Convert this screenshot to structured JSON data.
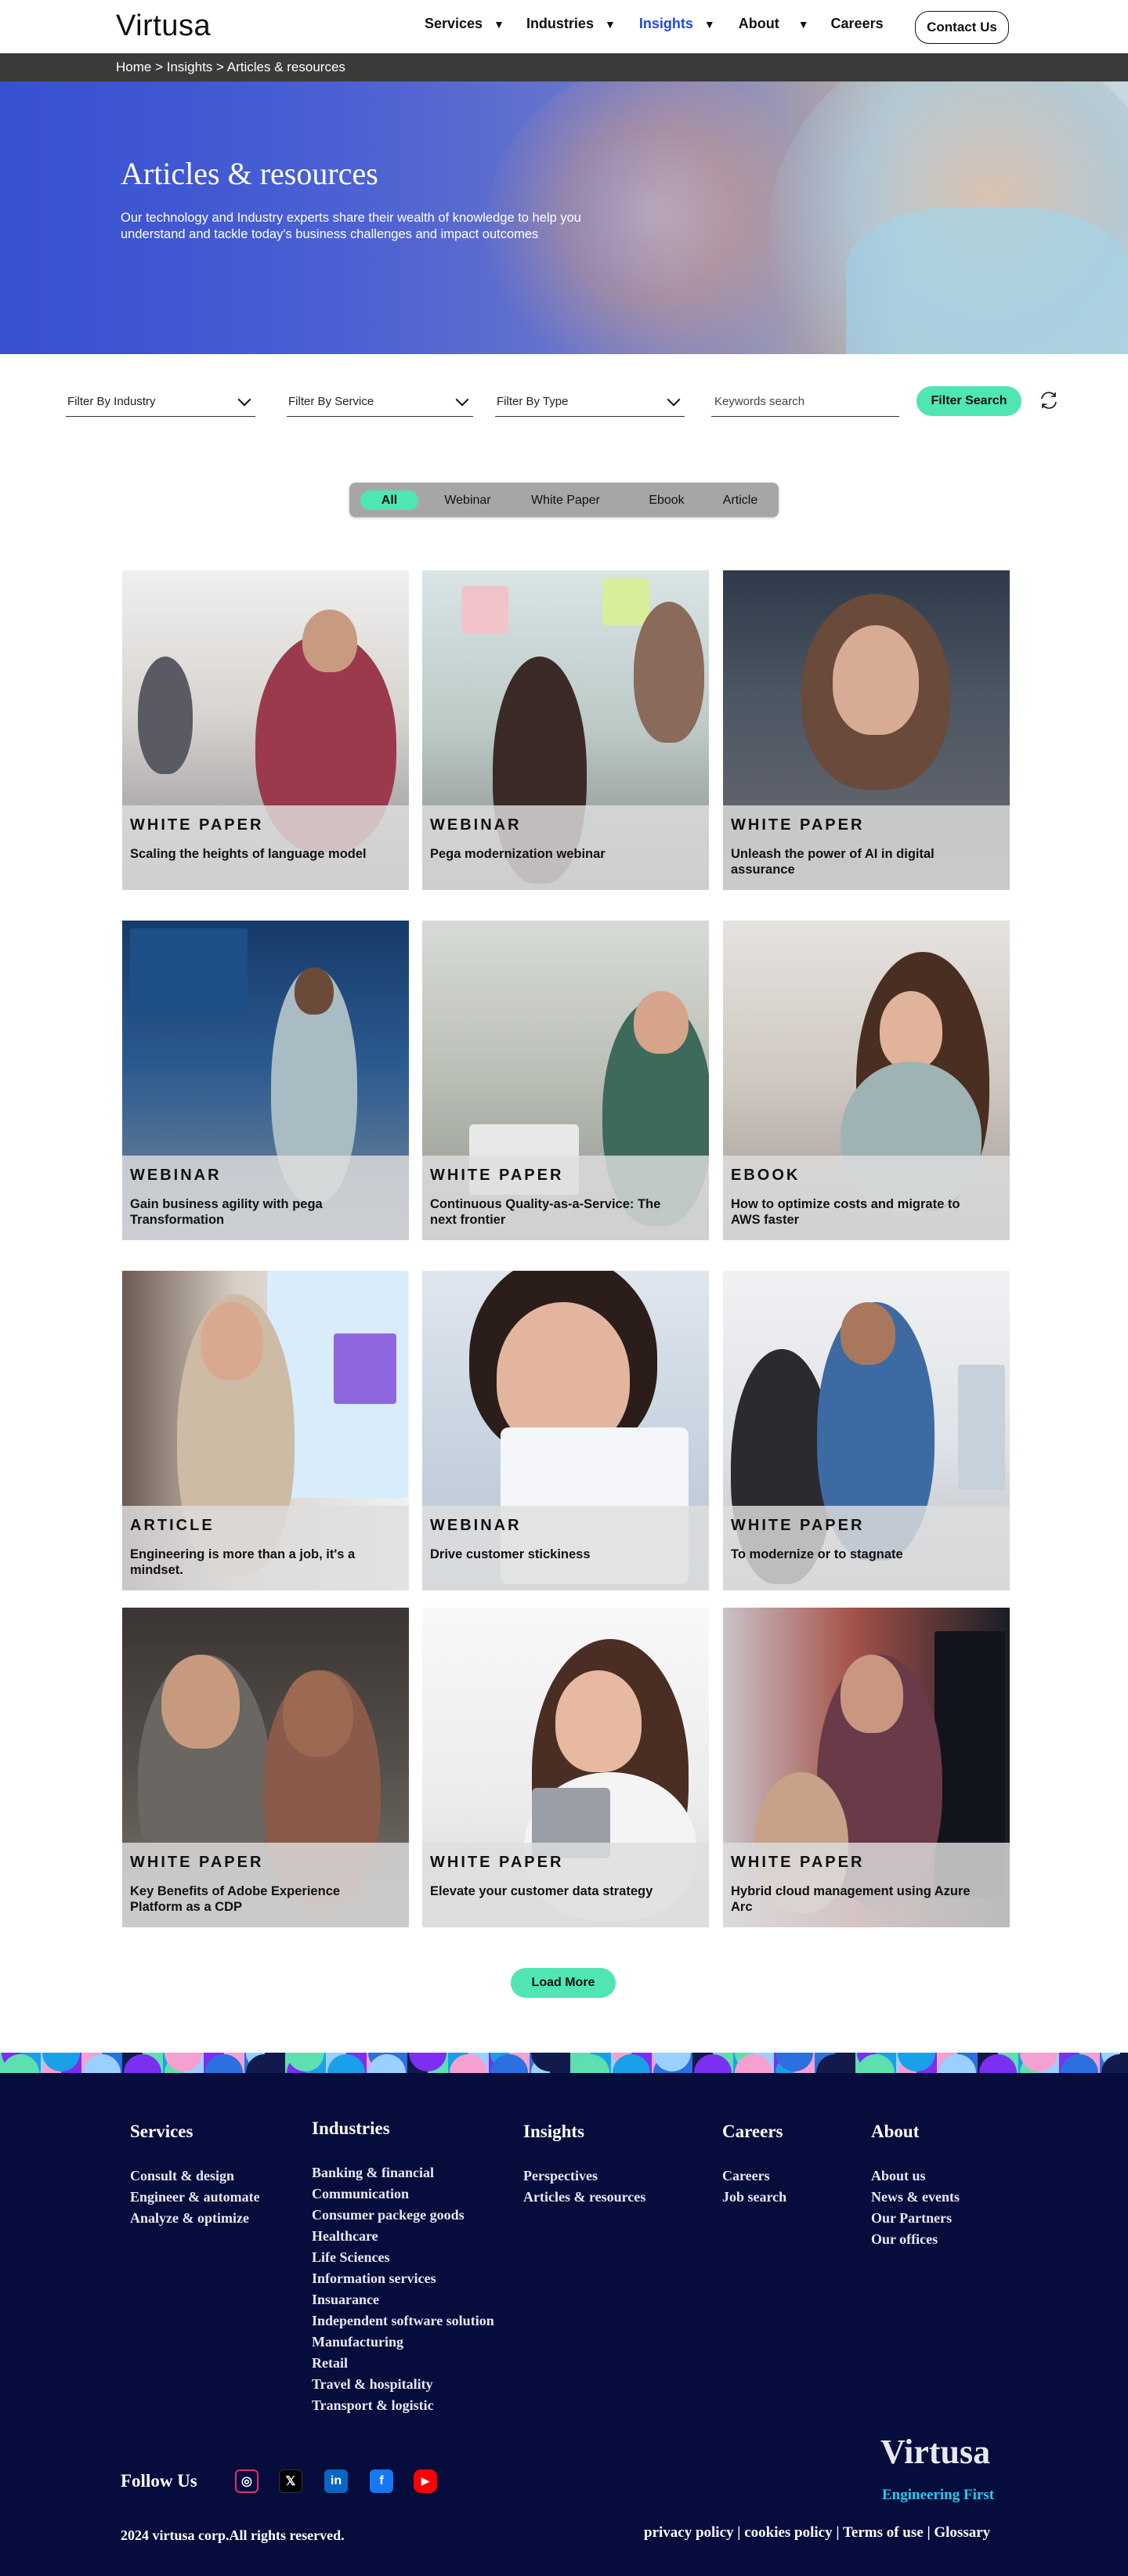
{
  "header": {
    "logo": "Virtusa",
    "nav": [
      {
        "label": "Services",
        "caret": "▼"
      },
      {
        "label": "Industries",
        "caret": "▼"
      },
      {
        "label": "Insights",
        "caret": "▼"
      },
      {
        "label": "About",
        "caret": "▼"
      },
      {
        "label": "Careers"
      }
    ],
    "contact_label": "Contact Us"
  },
  "breadcrumb": "Home > Insights > Articles & resources",
  "hero": {
    "title": "Articles & resources",
    "subtitle": "Our technology and Industry experts share their wealth of knowledge to help you understand and tackle today's business challenges and impact outcomes"
  },
  "filters": {
    "industry": "Filter By Industry",
    "service": "Filter By Service",
    "type": "Filter By Type",
    "search_placeholder": "Keywords search",
    "button": "Filter Search"
  },
  "tabs": [
    "All",
    "Webinar",
    "White Paper",
    "Ebook",
    "Article"
  ],
  "cards": [
    {
      "type": "WHITE PAPER",
      "title": "Scaling the heights of language model"
    },
    {
      "type": "WEBINAR",
      "title": "Pega modernization webinar"
    },
    {
      "type": "WHITE PAPER",
      "title": "Unleash the power of AI in digital assurance"
    },
    {
      "type": "WEBINAR",
      "title": "Gain business agility with pega Transformation"
    },
    {
      "type": "WHITE PAPER",
      "title": "Continuous Quality-as-a-Service: The next frontier"
    },
    {
      "type": "EBOOK",
      "title": "How to optimize costs and migrate to AWS faster"
    },
    {
      "type": "ARTICLE",
      "title": "Engineering is more than  a job, it's a mindset."
    },
    {
      "type": "WEBINAR",
      "title": "Drive customer stickiness"
    },
    {
      "type": "WHITE PAPER",
      "title": "To modernize or to stagnate"
    },
    {
      "type": "WHITE PAPER",
      "title": "Key Benefits of Adobe Experience Platform as a CDP"
    },
    {
      "type": "WHITE PAPER",
      "title": "Elevate your customer data strategy"
    },
    {
      "type": "WHITE PAPER",
      "title": "Hybrid cloud management using Azure Arc"
    }
  ],
  "load_more": "Load More",
  "footer": {
    "columns": [
      {
        "heading": "Services",
        "links": [
          "Consult & design",
          "Engineer & automate",
          "Analyze & optimize"
        ]
      },
      {
        "heading": "Industries",
        "links": [
          "Banking & financial",
          "Communication",
          "Consumer packege goods",
          "Healthcare",
          "Life Sciences",
          "Information services",
          "Insuarance",
          "Independent software solution",
          "Manufacturing",
          "Retail",
          "Travel & hospitality",
          "Transport & logistic"
        ]
      },
      {
        "heading": "Insights",
        "links": [
          "Perspectives",
          "Articles & resources"
        ]
      },
      {
        "heading": "Careers",
        "links": [
          "Careers",
          "Job search"
        ]
      },
      {
        "heading": "About",
        "links": [
          "About us",
          "News & events",
          "Our Partners",
          "Our offices"
        ]
      }
    ],
    "follow": "Follow Us",
    "social": [
      {
        "icon": "instagram-icon",
        "glyph": "◎",
        "color": "#e1306c"
      },
      {
        "icon": "x-icon",
        "glyph": "𝕏",
        "color": "#000000"
      },
      {
        "icon": "linkedin-icon",
        "glyph": "in",
        "color": "#0a66c2"
      },
      {
        "icon": "facebook-icon",
        "glyph": "f",
        "color": "#1877f2"
      },
      {
        "icon": "youtube-icon",
        "glyph": "▶",
        "color": "#ff0000"
      }
    ],
    "logo": "Virtusa",
    "tagline": "Engineering First",
    "copyright": "2024 virtusa corp.All rights reserved.",
    "legal": "privacy policy | cookies policy | Terms of use | Glossary"
  },
  "colors": {
    "accent": "#4fe6b3",
    "active_nav": "#2447e0",
    "footer_bg": "#060c3c",
    "tagline": "#2ac8f0"
  }
}
